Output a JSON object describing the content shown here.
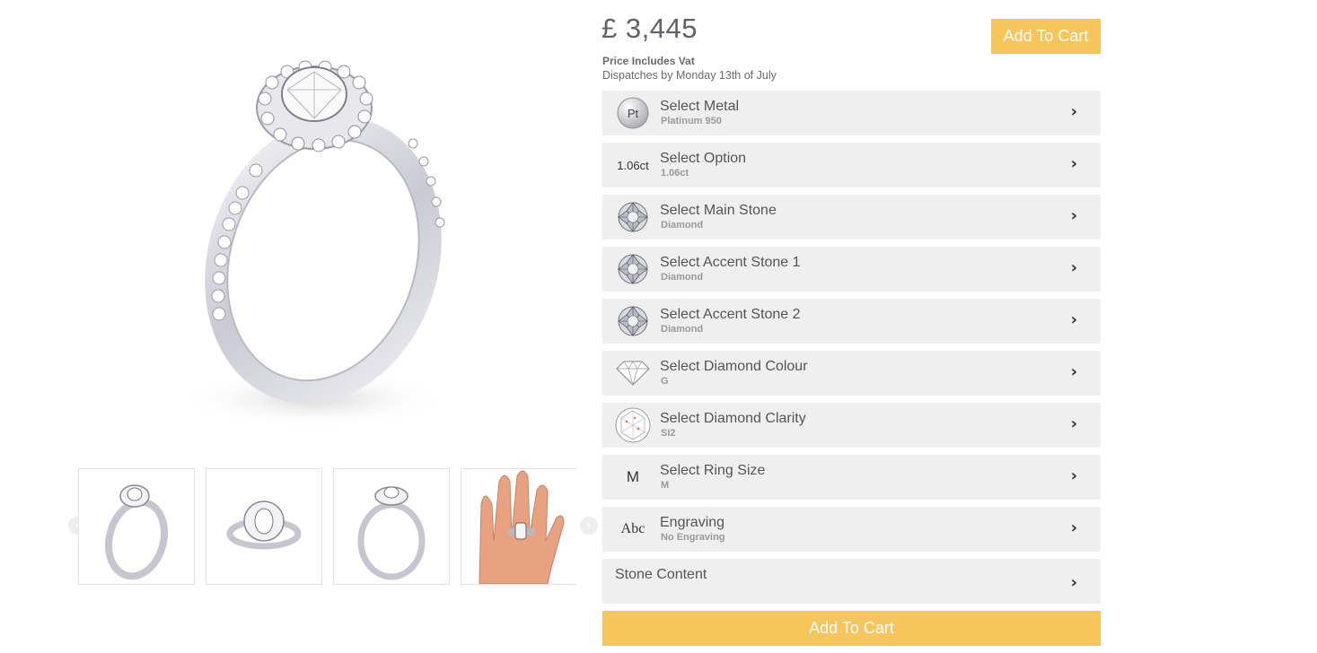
{
  "product": {
    "price": "£ 3,445",
    "vat_note": "Price Includes Vat",
    "dispatch_note": "Dispatches by Monday 13th of July"
  },
  "gallery": {
    "prev_icon": "‹",
    "next_icon": "›",
    "thumbnails": [
      "ring-side-view",
      "ring-top-view",
      "ring-front-view",
      "ring-on-hand"
    ]
  },
  "buttons": {
    "add_to_cart_top": "Add To Cart",
    "add_to_cart_bottom": "Add To Cart"
  },
  "options": [
    {
      "title": "Select Metal",
      "value": "Platinum 950",
      "icon": "platinum-icon",
      "icon_text": "Pt"
    },
    {
      "title": "Select Option",
      "value": "1.06ct",
      "icon": "carat-icon",
      "icon_text": "1.06ct"
    },
    {
      "title": "Select Main Stone",
      "value": "Diamond",
      "icon": "diamond-stone-icon"
    },
    {
      "title": "Select Accent Stone 1",
      "value": "Diamond",
      "icon": "diamond-stone-icon"
    },
    {
      "title": "Select Accent Stone 2",
      "value": "Diamond",
      "icon": "diamond-stone-icon"
    },
    {
      "title": "Select Diamond Colour",
      "value": "G",
      "icon": "diamond-outline-icon"
    },
    {
      "title": "Select Diamond Clarity",
      "value": "SI2",
      "icon": "clarity-icon"
    },
    {
      "title": "Select Ring Size",
      "value": "M",
      "icon": "ring-size-icon",
      "icon_text": "M"
    },
    {
      "title": "Engraving",
      "value": "No Engraving",
      "icon": "engraving-icon",
      "icon_text": "Abc"
    },
    {
      "title": "Stone Content",
      "value": ""
    }
  ],
  "chevron": "›",
  "colors": {
    "accent": "#f6c55c",
    "row_bg": "#efefef",
    "text": "#555555"
  }
}
